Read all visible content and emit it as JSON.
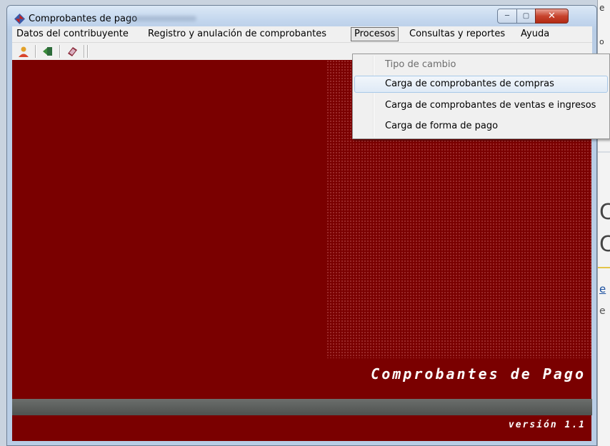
{
  "window": {
    "title": "Comprobantes de pago"
  },
  "menubar": {
    "items": [
      {
        "label": "Datos del contribuyente"
      },
      {
        "label": "Registro y anulación de comprobantes"
      },
      {
        "label": "Procesos"
      },
      {
        "label": "Consultas y reportes"
      },
      {
        "label": "Ayuda"
      }
    ],
    "active": "Procesos"
  },
  "toolbar": {
    "buttons": [
      "user-icon",
      "exit-icon",
      "book-icon"
    ]
  },
  "dropdown": {
    "items": [
      {
        "label": "Tipo de cambio",
        "state": "disabled"
      },
      {
        "label": "Carga de comprobantes de compras",
        "state": "hover"
      },
      {
        "label": "Carga de comprobantes de ventas e ingresos",
        "state": "normal"
      },
      {
        "label": "Carga de forma de pago",
        "state": "normal"
      }
    ]
  },
  "banner": {
    "title": "Comprobantes de Pago",
    "version": "versión 1.1"
  },
  "colors": {
    "background": "#7a0000",
    "menu_bg": "#f0f0f0",
    "close_button": "#c7442e"
  }
}
